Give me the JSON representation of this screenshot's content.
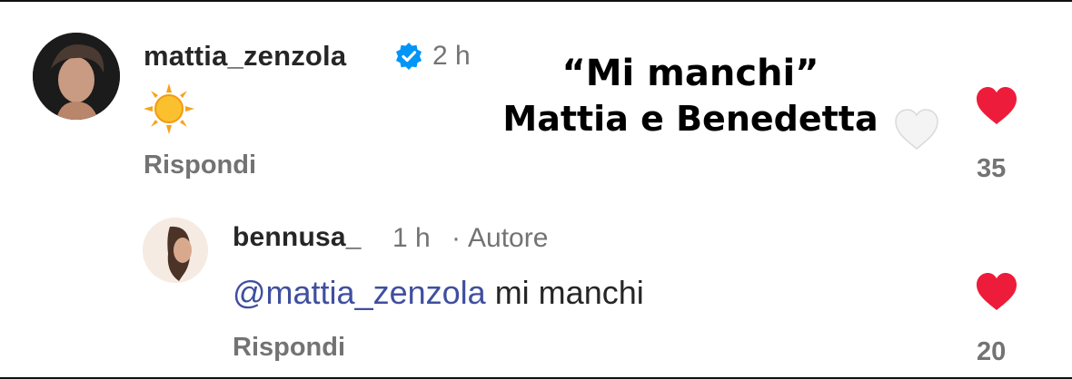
{
  "overlay": {
    "line1": "“Mi manchi”",
    "line2": "Mattia e Benedetta",
    "emoji": "white-heart-icon"
  },
  "comment": {
    "username": "mattia_zenzola",
    "verified": true,
    "time": "2 h",
    "body_emoji": "sun-icon",
    "reply_label": "Rispondi",
    "like_count": "35"
  },
  "reply": {
    "username": "bennusa_",
    "time": "1 h",
    "separator": "·",
    "author_badge": "Autore",
    "mention": "@mattia_zenzola",
    "text": " mi manchi",
    "reply_label": "Rispondi",
    "like_count": "20"
  },
  "colors": {
    "heart": "#ed1c3a",
    "mention": "#3f4f9f",
    "verified": "#0095f6",
    "muted_text": "#737373"
  }
}
